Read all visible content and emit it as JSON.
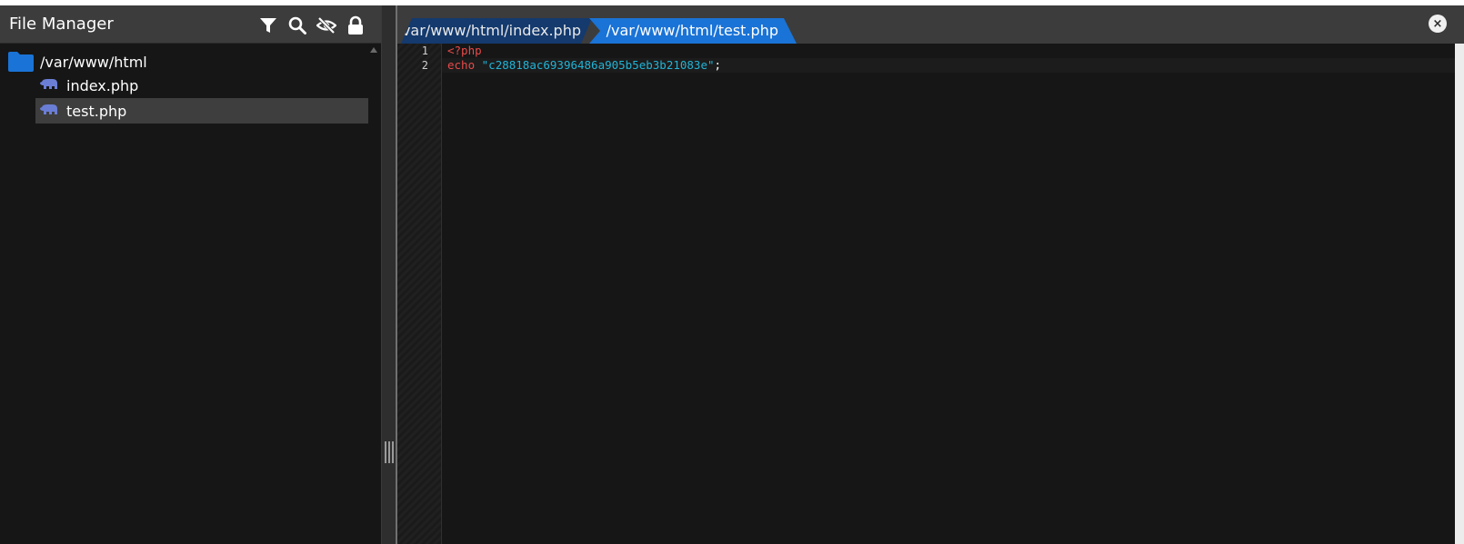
{
  "file_manager": {
    "title": "File Manager",
    "icons": [
      "filter-icon",
      "search-icon",
      "hidden-eye-icon",
      "lock-icon"
    ],
    "root_folder": "/var/www/html",
    "files": [
      {
        "name": "index.php",
        "selected": false
      },
      {
        "name": "test.php",
        "selected": true
      }
    ]
  },
  "editor": {
    "tabs": [
      {
        "label": "/var/www/html/index.php",
        "active": false
      },
      {
        "label": "/var/www/html/test.php",
        "active": true
      }
    ],
    "line_numbers": [
      "1",
      "2"
    ],
    "code": {
      "line1_tag": "<?php",
      "line2_keyword": "echo",
      "line2_string": "\"c28818ac69396486a905b5eb3b21083e\"",
      "line2_semicolon": ";"
    },
    "close_symbol": "×"
  },
  "colors": {
    "background": "#161616",
    "header": "#3c3c3c",
    "active_tab": "#1a73d6",
    "inactive_tab": "#143a6e",
    "folder": "#1a73d6",
    "php_icon": "#6a7ed6",
    "keyword": "#e84a4a",
    "string": "#21b4d6"
  }
}
